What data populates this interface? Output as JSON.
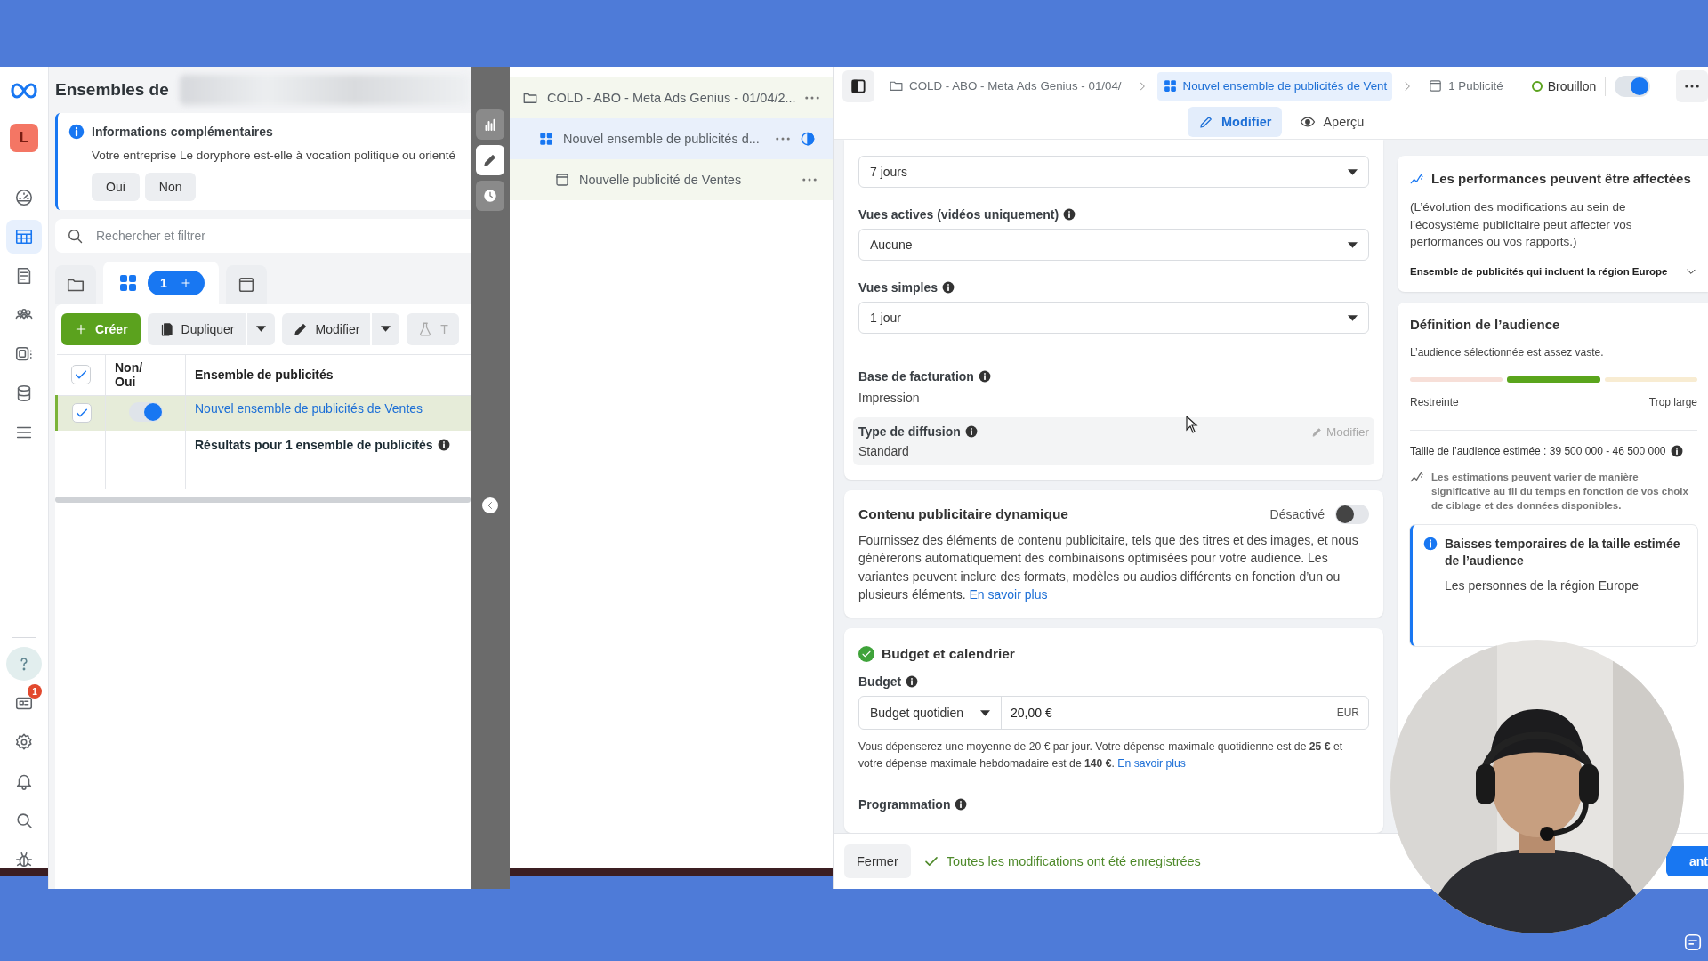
{
  "rail": {
    "avatar": "L",
    "items": [
      {
        "kind": "gauge",
        "selected": false
      },
      {
        "kind": "table",
        "selected": true
      },
      {
        "kind": "document",
        "selected": false
      },
      {
        "kind": "people",
        "selected": false
      },
      {
        "kind": "layers",
        "selected": false
      },
      {
        "kind": "database",
        "selected": false
      },
      {
        "kind": "menu",
        "selected": false
      }
    ],
    "bottom": [
      {
        "kind": "help",
        "selected": true
      },
      {
        "kind": "newspaper",
        "selected": false,
        "badge": "1"
      },
      {
        "kind": "settings",
        "selected": false
      },
      {
        "kind": "bell",
        "selected": false
      },
      {
        "kind": "search",
        "selected": false
      },
      {
        "kind": "bug",
        "selected": false
      }
    ]
  },
  "left_panel": {
    "title": "Ensembles de",
    "notice": {
      "title": "Informations complémentaires",
      "text": "Votre entreprise Le doryphore est-elle à vocation politique ou orienté",
      "buttons": [
        "Oui",
        "Non"
      ]
    },
    "search": {
      "placeholder": "Rechercher et filtrer"
    },
    "view_tabs": [
      {
        "kind": "folder",
        "selected": false
      },
      {
        "kind": "adsets",
        "selected": true,
        "count": "1"
      },
      {
        "kind": "ad",
        "selected": false
      }
    ],
    "toolbar": [
      {
        "kind": "create",
        "label": "Créer"
      },
      {
        "kind": "duplicate",
        "label": "Dupliquer"
      },
      {
        "kind": "edit",
        "label": "Modifier"
      },
      {
        "kind": "test",
        "label": "T"
      }
    ],
    "table": {
      "columns": [
        "Non/ Oui",
        "Ensemble de publicités"
      ],
      "header_checked": true,
      "rows": [
        {
          "checked": true,
          "on": true,
          "name": "Nouvel ensemble de publicités de Ventes"
        }
      ],
      "summary": "Résultats pour 1 ensemble de publicités"
    }
  },
  "tools": [
    {
      "kind": "chart",
      "selected": false
    },
    {
      "kind": "edit",
      "selected": true
    },
    {
      "kind": "history",
      "selected": false
    }
  ],
  "tree": [
    {
      "kind": "campaign",
      "label": "COLD - ABO - Meta Ads Genius - 01/04/2...",
      "selected": false,
      "children": [
        {
          "kind": "adset",
          "label": "Nouvel ensemble de publicités d...",
          "selected": true,
          "children": [
            {
              "kind": "ad",
              "label": "Nouvelle publicité de Ventes",
              "selected": false
            }
          ]
        }
      ]
    }
  ],
  "top_bar": {
    "breadcrumbs": [
      {
        "kind": "campaign",
        "label": "COLD - ABO - Meta Ads Genius - 01/04/",
        "selected": false
      },
      {
        "kind": "adset",
        "label": "Nouvel ensemble de publicités de Vent",
        "selected": true
      },
      {
        "kind": "ad",
        "label": "1 Publicité",
        "selected": false
      }
    ],
    "status": "Brouillon",
    "on": true
  },
  "mode_tabs": [
    {
      "kind": "edit",
      "label": "Modifier",
      "selected": true
    },
    {
      "kind": "preview",
      "label": "Aperçu",
      "selected": false
    }
  ],
  "form": {
    "fields": [
      {
        "kind": "select",
        "value": "7 jours"
      },
      {
        "kind": "select",
        "label": "Vues actives (vidéos uniquement)",
        "value": "Aucune"
      },
      {
        "kind": "select",
        "label": "Vues simples",
        "value": "1 jour"
      },
      {
        "kind": "static",
        "label": "Base de facturation",
        "value": "Impression"
      },
      {
        "kind": "editable",
        "label": "Type de diffusion",
        "value": "Standard",
        "action": "Modifier"
      }
    ]
  },
  "dynamic_card": {
    "title": "Contenu publicitaire dynamique",
    "toggle_label": "Désactivé",
    "on": false,
    "text": "Fournissez des éléments de contenu publicitaire, tels que des titres et des images, et nous générerons automatiquement des combinaisons optimisées pour votre audience. Les variantes peuvent inclure des formats, modèles ou audios différents en fonction d’un ou plusieurs éléments.",
    "link": "En savoir plus"
  },
  "budget_card": {
    "title": "Budget et calendrier",
    "complete": true,
    "budget_label": "Budget",
    "budget_type": "Budget quotidien",
    "amount": "20,00 €",
    "currency": "EUR",
    "note": "Vous dépenserez une moyenne de 20 € par jour. Votre dépense maximale quotidienne est de **25 €** et votre dépense maximale hebdomadaire est de **140 €**.",
    "note_link": "En savoir plus",
    "schedule_label": "Programmation"
  },
  "footer": {
    "close": "Fermer",
    "saved": "Toutes les modifications ont été enregistrées",
    "next": "ant"
  },
  "performance_card": {
    "title": "Les performances peuvent être affectées",
    "text": "(L’évolution des modifications au sein de l’écosystème publicitaire peut affecter vos performances ou vos rapports.)",
    "expander": "Ensemble de publicités qui incluent la région Europe"
  },
  "audience_card": {
    "title": "Définition de l’audience",
    "summary": "L’audience sélectionnée est assez vaste.",
    "segments": [
      {
        "color": "#f7dfd8",
        "selected": false
      },
      {
        "color": "#5aa51c",
        "selected": true
      },
      {
        "color": "#f8ecd2",
        "selected": false
      }
    ],
    "low": "Restreinte",
    "high": "Trop large",
    "size": "Taille de l’audience estimée : 39 500 000 - 46 500 000",
    "estimate_note": "Les estimations peuvent varier de manière significative au fil du temps en fonction de vos choix de ciblage et des données disponibles.",
    "alert": {
      "title": "Baisses temporaires de la taille estimée de l’audience",
      "text": "Les personnes de la région Europe"
    }
  }
}
